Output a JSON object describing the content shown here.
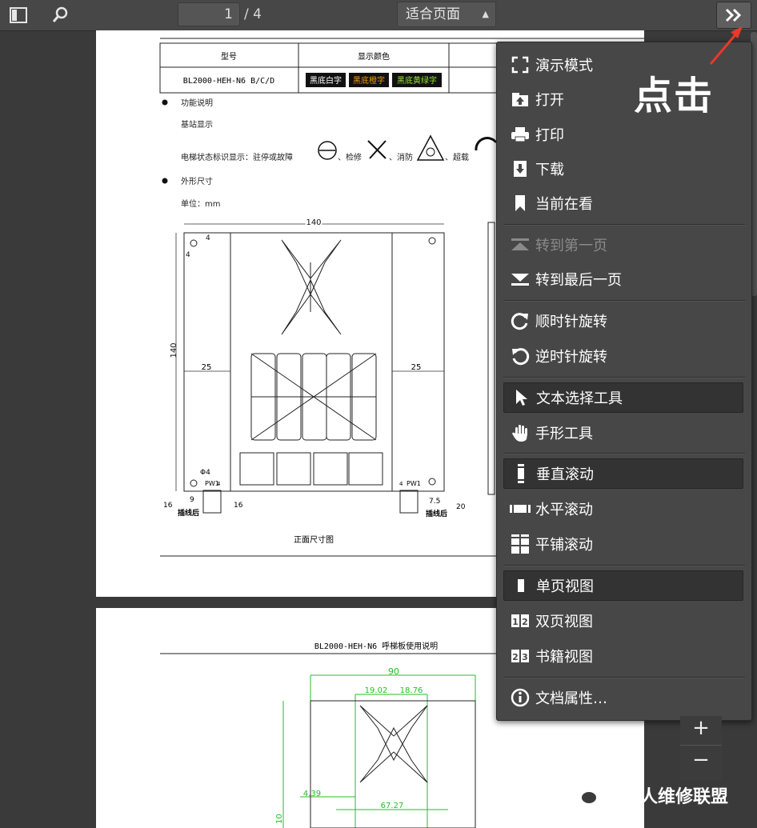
{
  "toolbar": {
    "page_current": "1",
    "page_total": "/ 4",
    "zoom_value": "适合页面",
    "sidebar_icon": "sidebar-toggle-icon",
    "search_icon": "search-icon",
    "more_icon": "double-chevron-right-icon"
  },
  "page1": {
    "table_header_model": "型号",
    "table_header_color": "显示颜色",
    "table_model_value": "BL2000-HEH-N6 B/C/D",
    "swatch_1": "黑底白字",
    "swatch_2": "黑底橙字",
    "swatch_3": "黑底黄绿字",
    "bullet_1": "功能说明",
    "base_display": "基站显示",
    "status_text": "电梯状态标识显示：驻停或故障",
    "status_sep_1": "、检修",
    "status_sep_2": "、消防",
    "status_sep_3": "、超载",
    "bullet_2": "外形尺寸",
    "unit": "单位：mm",
    "dim_140_w": "140",
    "dim_140_h": "140",
    "dim_4a": "4",
    "dim_4b": "4",
    "dim_25_left": "25",
    "dim_25_right": "25",
    "dim_phi4": "Φ4",
    "pw_left": "PW1",
    "pw_right": "PW1",
    "pw_left_num": "4",
    "pw_right_num": "4",
    "dim_9": "9",
    "dim_16_left": "16",
    "dim_16_mid": "16",
    "dim_75": "7.5",
    "dim_20": "20",
    "after_wiring_left": "插线后",
    "after_wiring_right": "插线后",
    "caption": "正面尺寸图"
  },
  "page2": {
    "header": "BL2000-HEH-N6 呼梯板使用说明",
    "dim_90": "90",
    "dim_1902": "19.02",
    "dim_1876": "18.76",
    "dim_439": "4.39",
    "dim_6727": "67.27",
    "dim_10": "10"
  },
  "menu": {
    "items": [
      {
        "label": "演示模式",
        "icon": "presentation-icon"
      },
      {
        "label": "打开",
        "icon": "open-icon"
      },
      {
        "label": "打印",
        "icon": "print-icon"
      },
      {
        "label": "下载",
        "icon": "download-icon"
      },
      {
        "label": "当前在看",
        "icon": "bookmark-icon"
      },
      {
        "label": "转到第一页",
        "icon": "first-page-icon"
      },
      {
        "label": "转到最后一页",
        "icon": "last-page-icon"
      },
      {
        "label": "顺时针旋转",
        "icon": "rotate-cw-icon"
      },
      {
        "label": "逆时针旋转",
        "icon": "rotate-ccw-icon"
      },
      {
        "label": "文本选择工具",
        "icon": "cursor-icon"
      },
      {
        "label": "手形工具",
        "icon": "hand-icon"
      },
      {
        "label": "垂直滚动",
        "icon": "vertical-scroll-icon"
      },
      {
        "label": "水平滚动",
        "icon": "horizontal-scroll-icon"
      },
      {
        "label": "平铺滚动",
        "icon": "wrapped-scroll-icon"
      },
      {
        "label": "单页视图",
        "icon": "single-page-icon"
      },
      {
        "label": "双页视图",
        "icon": "two-page-icon"
      },
      {
        "label": "书籍视图",
        "icon": "book-view-icon"
      },
      {
        "label": "文档属性…",
        "icon": "info-icon"
      }
    ]
  },
  "annotation": {
    "click_text": "点击"
  },
  "zoom_controls": {
    "plus": "+",
    "minus": "−"
  },
  "watermark": {
    "text": "电梯人维修联盟"
  },
  "colors": {
    "toolbar_bg": "#474747",
    "menu_bg": "#474747",
    "annotation_arrow": "#e8392a",
    "drawing_green": "#22c022"
  }
}
